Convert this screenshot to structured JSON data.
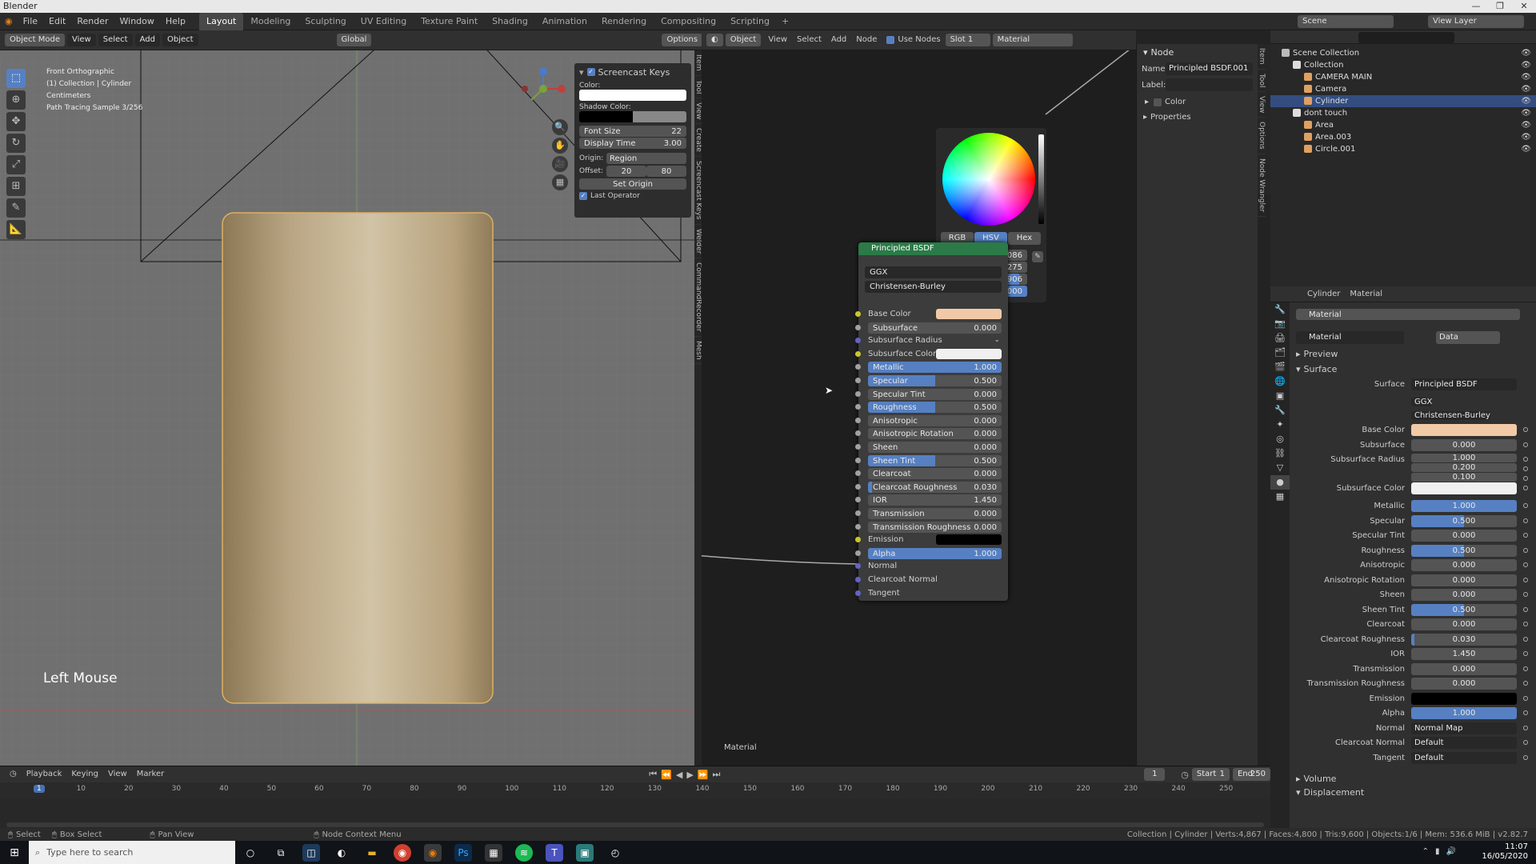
{
  "app": {
    "title": "Blender"
  },
  "menu": [
    "File",
    "Edit",
    "Render",
    "Window",
    "Help"
  ],
  "workspaces": [
    "Layout",
    "Modeling",
    "Sculpting",
    "UV Editing",
    "Texture Paint",
    "Shading",
    "Animation",
    "Rendering",
    "Compositing",
    "Scripting"
  ],
  "topright": {
    "scene": "Scene",
    "view_layer": "View Layer"
  },
  "viewport": {
    "mode": "Object Mode",
    "menu": [
      "View",
      "Select",
      "Add",
      "Object"
    ],
    "transform": "Global",
    "options": "Options",
    "info": [
      "Front Orthographic",
      "(1) Collection | Cylinder",
      "Centimeters",
      "Path Tracing Sample 3/256"
    ],
    "left_mouse": "Left Mouse",
    "screencast": {
      "title": "Screencast Keys",
      "color_label": "Color:",
      "shadow_label": "Shadow Color:",
      "font_size_label": "Font Size",
      "font_size": "22",
      "display_time_label": "Display Time",
      "display_time": "3.00",
      "origin_label": "Origin:",
      "origin": "Region",
      "offset_label": "Offset:",
      "offset_x": "20",
      "offset_y": "80",
      "set_origin": "Set Origin",
      "last_operator": "Last Operator"
    },
    "side_tabs": [
      "Item",
      "Tool",
      "View",
      "Create",
      "Screencast Keys",
      "Welder",
      "CommandRecorder",
      "Mesh"
    ]
  },
  "node_editor": {
    "header": {
      "object": "Object",
      "menu": [
        "View",
        "Select",
        "Add",
        "Node"
      ],
      "use_nodes": "Use Nodes",
      "slot": "Slot 1",
      "material": "Material"
    },
    "footer_label": "Material",
    "picker": {
      "tabs": [
        "RGB",
        "HSV",
        "Hex"
      ],
      "h": "0.086",
      "s": "0.275",
      "v": "0.906",
      "a": "1.000",
      "h_label": "H",
      "s_label": "S",
      "v_label": "V",
      "a_label": "A"
    },
    "node": {
      "title": "Principled BSDF",
      "distribution": "GGX",
      "subsurface_method": "Christensen-Burley",
      "rows": [
        {
          "label": "Base Color",
          "type": "color",
          "color": "#f2c9a6",
          "sock": "y"
        },
        {
          "label": "Subsurface",
          "value": "0.000",
          "fill": 0,
          "sock": "g"
        },
        {
          "label": "Subsurface Radius",
          "type": "dropdown",
          "sock": "b"
        },
        {
          "label": "Subsurface Color",
          "type": "color",
          "color": "#f0f0f0",
          "sock": "y"
        },
        {
          "label": "Metallic",
          "value": "1.000",
          "fill": 1,
          "sock": "g"
        },
        {
          "label": "Specular",
          "value": "0.500",
          "fill": 0.5,
          "sock": "g"
        },
        {
          "label": "Specular Tint",
          "value": "0.000",
          "fill": 0,
          "sock": "g"
        },
        {
          "label": "Roughness",
          "value": "0.500",
          "fill": 0.5,
          "sock": "g"
        },
        {
          "label": "Anisotropic",
          "value": "0.000",
          "fill": 0,
          "sock": "g"
        },
        {
          "label": "Anisotropic Rotation",
          "value": "0.000",
          "fill": 0,
          "sock": "g"
        },
        {
          "label": "Sheen",
          "value": "0.000",
          "fill": 0,
          "sock": "g"
        },
        {
          "label": "Sheen Tint",
          "value": "0.500",
          "fill": 0.5,
          "sock": "g"
        },
        {
          "label": "Clearcoat",
          "value": "0.000",
          "fill": 0,
          "sock": "g"
        },
        {
          "label": "Clearcoat Roughness",
          "value": "0.030",
          "fill": 0.03,
          "sock": "g"
        },
        {
          "label": "IOR",
          "value": "1.450",
          "fill": 0,
          "sock": "g"
        },
        {
          "label": "Transmission",
          "value": "0.000",
          "fill": 0,
          "sock": "g"
        },
        {
          "label": "Transmission Roughness",
          "value": "0.000",
          "fill": 0,
          "sock": "g"
        },
        {
          "label": "Emission",
          "type": "color",
          "color": "#000000",
          "sock": "y"
        },
        {
          "label": "Alpha",
          "value": "1.000",
          "fill": 1,
          "sock": "g"
        },
        {
          "label": "Normal",
          "type": "plain",
          "sock": "b"
        },
        {
          "label": "Clearcoat Normal",
          "type": "plain",
          "sock": "b"
        },
        {
          "label": "Tangent",
          "type": "plain",
          "sock": "b"
        }
      ]
    }
  },
  "node_sidebar": {
    "section": "Node",
    "name_label": "Name:",
    "name": "Principled BSDF.001",
    "label_label": "Label:",
    "color": "Color",
    "properties": "Properties",
    "tabs": [
      "Item",
      "Tool",
      "View",
      "Options",
      "Node Wrangler"
    ]
  },
  "outliner": {
    "items": [
      {
        "name": "Scene Collection",
        "depth": 0,
        "icon": "#bbb"
      },
      {
        "name": "Collection",
        "depth": 1,
        "icon": "#ddd"
      },
      {
        "name": "CAMERA MAIN",
        "depth": 2,
        "icon": "#e0a060"
      },
      {
        "name": "Camera",
        "depth": 2,
        "icon": "#e0a060"
      },
      {
        "name": "Cylinder",
        "depth": 2,
        "icon": "#e0a060",
        "selected": true
      },
      {
        "name": "dont touch",
        "depth": 1,
        "icon": "#ddd"
      },
      {
        "name": "Area",
        "depth": 2,
        "icon": "#e0a060"
      },
      {
        "name": "Area.003",
        "depth": 2,
        "icon": "#e0a060"
      },
      {
        "name": "Circle.001",
        "depth": 2,
        "icon": "#e0a060"
      }
    ]
  },
  "properties": {
    "breadcrumb_object": "Cylinder",
    "breadcrumb_material": "Material",
    "slot": "Material",
    "material": "Material",
    "data": "Data",
    "preview": "Preview",
    "surface_section": "Surface",
    "surface_label": "Surface",
    "surface": "Principled BSDF",
    "ggx": "GGX",
    "christensen": "Christensen-Burley",
    "rows": [
      {
        "label": "Base Color",
        "type": "color",
        "color": "#f2c9a6"
      },
      {
        "label": "Subsurface",
        "value": "0.000",
        "fill": 0
      },
      {
        "label": "Subsurface Radius",
        "value": "1.000",
        "fill": 0
      },
      {
        "label": "",
        "value": "0.200",
        "fill": 0
      },
      {
        "label": "",
        "value": "0.100",
        "fill": 0
      },
      {
        "label": "Subsurface Color",
        "type": "color",
        "color": "#f0f0f0"
      },
      {
        "label": "Metallic",
        "value": "1.000",
        "fill": 1
      },
      {
        "label": "Specular",
        "value": "0.500",
        "fill": 0.5
      },
      {
        "label": "Specular Tint",
        "value": "0.000",
        "fill": 0
      },
      {
        "label": "Roughness",
        "value": "0.500",
        "fill": 0.5
      },
      {
        "label": "Anisotropic",
        "value": "0.000",
        "fill": 0
      },
      {
        "label": "Anisotropic Rotation",
        "value": "0.000",
        "fill": 0
      },
      {
        "label": "Sheen",
        "value": "0.000",
        "fill": 0
      },
      {
        "label": "Sheen Tint",
        "value": "0.500",
        "fill": 0.5
      },
      {
        "label": "Clearcoat",
        "value": "0.000",
        "fill": 0
      },
      {
        "label": "Clearcoat Roughness",
        "value": "0.030",
        "fill": 0.03
      },
      {
        "label": "IOR",
        "value": "1.450",
        "fill": 0
      },
      {
        "label": "Transmission",
        "value": "0.000",
        "fill": 0
      },
      {
        "label": "Transmission Roughness",
        "value": "0.000",
        "fill": 0
      },
      {
        "label": "Emission",
        "type": "color",
        "color": "#000000"
      },
      {
        "label": "Alpha",
        "value": "1.000",
        "fill": 1
      },
      {
        "label": "Normal",
        "type": "text",
        "value": "Normal Map"
      },
      {
        "label": "Clearcoat Normal",
        "type": "text",
        "value": "Default"
      },
      {
        "label": "Tangent",
        "type": "text",
        "value": "Default"
      }
    ],
    "volume": "Volume",
    "displacement": "Displacement"
  },
  "timeline": {
    "menu": [
      "Playback",
      "Keying",
      "View",
      "Marker"
    ],
    "current": "1",
    "start_label": "Start",
    "start": "1",
    "end_label": "End",
    "end": "250",
    "ticks": [
      "1",
      "10",
      "20",
      "30",
      "40",
      "50",
      "60",
      "70",
      "80",
      "90",
      "100",
      "110",
      "120",
      "130",
      "140",
      "150",
      "160",
      "170",
      "180",
      "190",
      "200",
      "210",
      "220",
      "230",
      "240",
      "250"
    ]
  },
  "status": {
    "select": "Select",
    "box_select": "Box Select",
    "pan_view": "Pan View",
    "node_context": "Node Context Menu",
    "stats": "Collection | Cylinder | Verts:4,867 | Faces:4,800 | Tris:9,600 | Objects:1/6 | Mem: 536.6 MiB | v2.82.7"
  },
  "taskbar": {
    "search": "Type here to search",
    "time": "11:07",
    "date": "16/05/2020"
  }
}
